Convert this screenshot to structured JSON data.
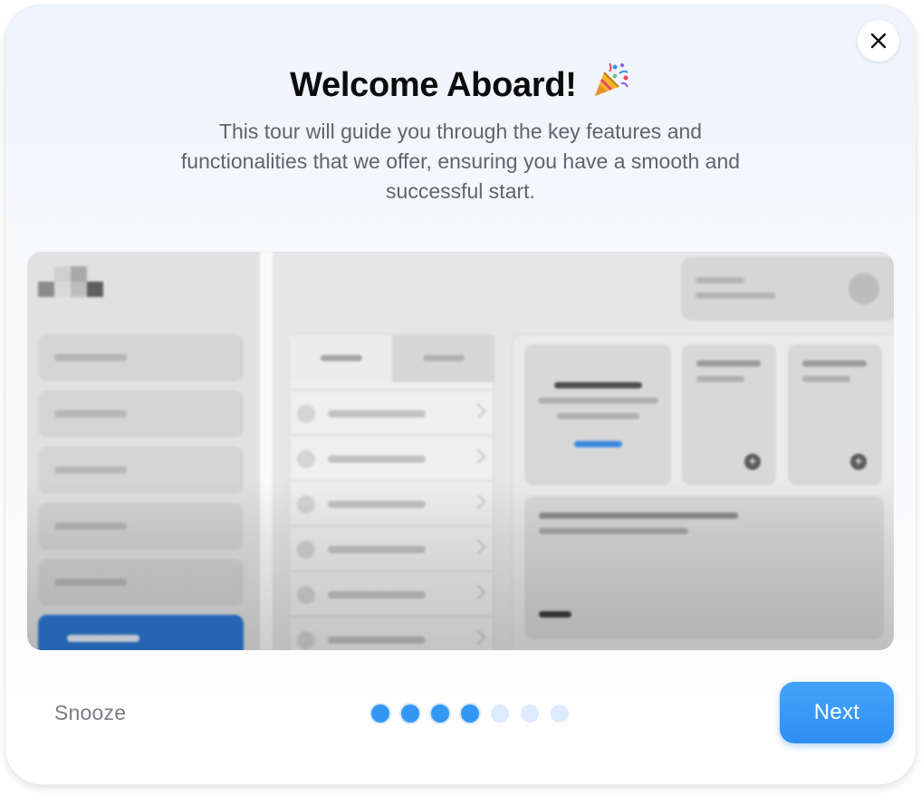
{
  "dialog": {
    "title": "Welcome Aboard!",
    "title_icon": "party-popper-icon",
    "subtitle": "This tour will guide you through the key features and functionalities that we offer, ensuring you have a smooth and successful start.",
    "close_icon": "close-icon"
  },
  "footer": {
    "snooze_label": "Snooze",
    "next_label": "Next",
    "steps_total": 7,
    "steps_completed": 4
  },
  "colors": {
    "accent": "#3597f4",
    "step_inactive": "#dcebfd",
    "title": "#0c0c0c",
    "subtitle": "#61646b",
    "preview_active_nav": "#2b78d4"
  }
}
